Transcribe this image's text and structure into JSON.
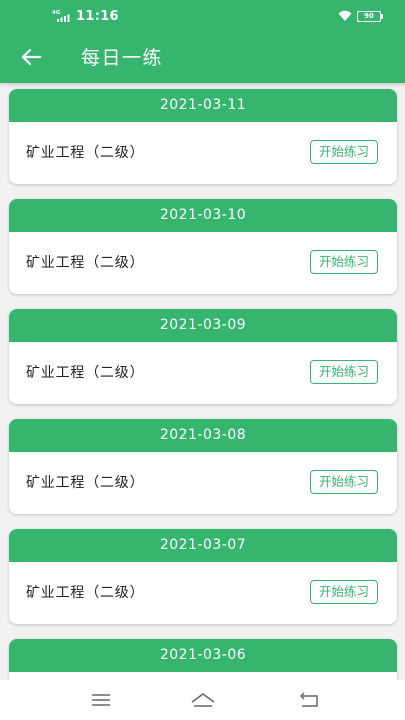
{
  "status_bar": {
    "network": "4G",
    "time": "11:16",
    "battery": "90",
    "icons": [
      "signal-icon",
      "wifi-icon",
      "battery-icon"
    ]
  },
  "app_bar": {
    "back_icon": "arrow-left-icon",
    "title": "每日一练"
  },
  "colors": {
    "primary": "#36b56f",
    "background": "#f2f2f2"
  },
  "practice_list": [
    {
      "date": "2021-03-11",
      "subject": "矿业工程（二级）",
      "action": "开始练习"
    },
    {
      "date": "2021-03-10",
      "subject": "矿业工程（二级）",
      "action": "开始练习"
    },
    {
      "date": "2021-03-09",
      "subject": "矿业工程（二级）",
      "action": "开始练习"
    },
    {
      "date": "2021-03-08",
      "subject": "矿业工程（二级）",
      "action": "开始练习"
    },
    {
      "date": "2021-03-07",
      "subject": "矿业工程（二级）",
      "action": "开始练习"
    },
    {
      "date": "2021-03-06",
      "subject": "",
      "action": ""
    }
  ],
  "nav_bar": {
    "icons": [
      "menu-icon",
      "home-icon",
      "back-icon"
    ]
  }
}
